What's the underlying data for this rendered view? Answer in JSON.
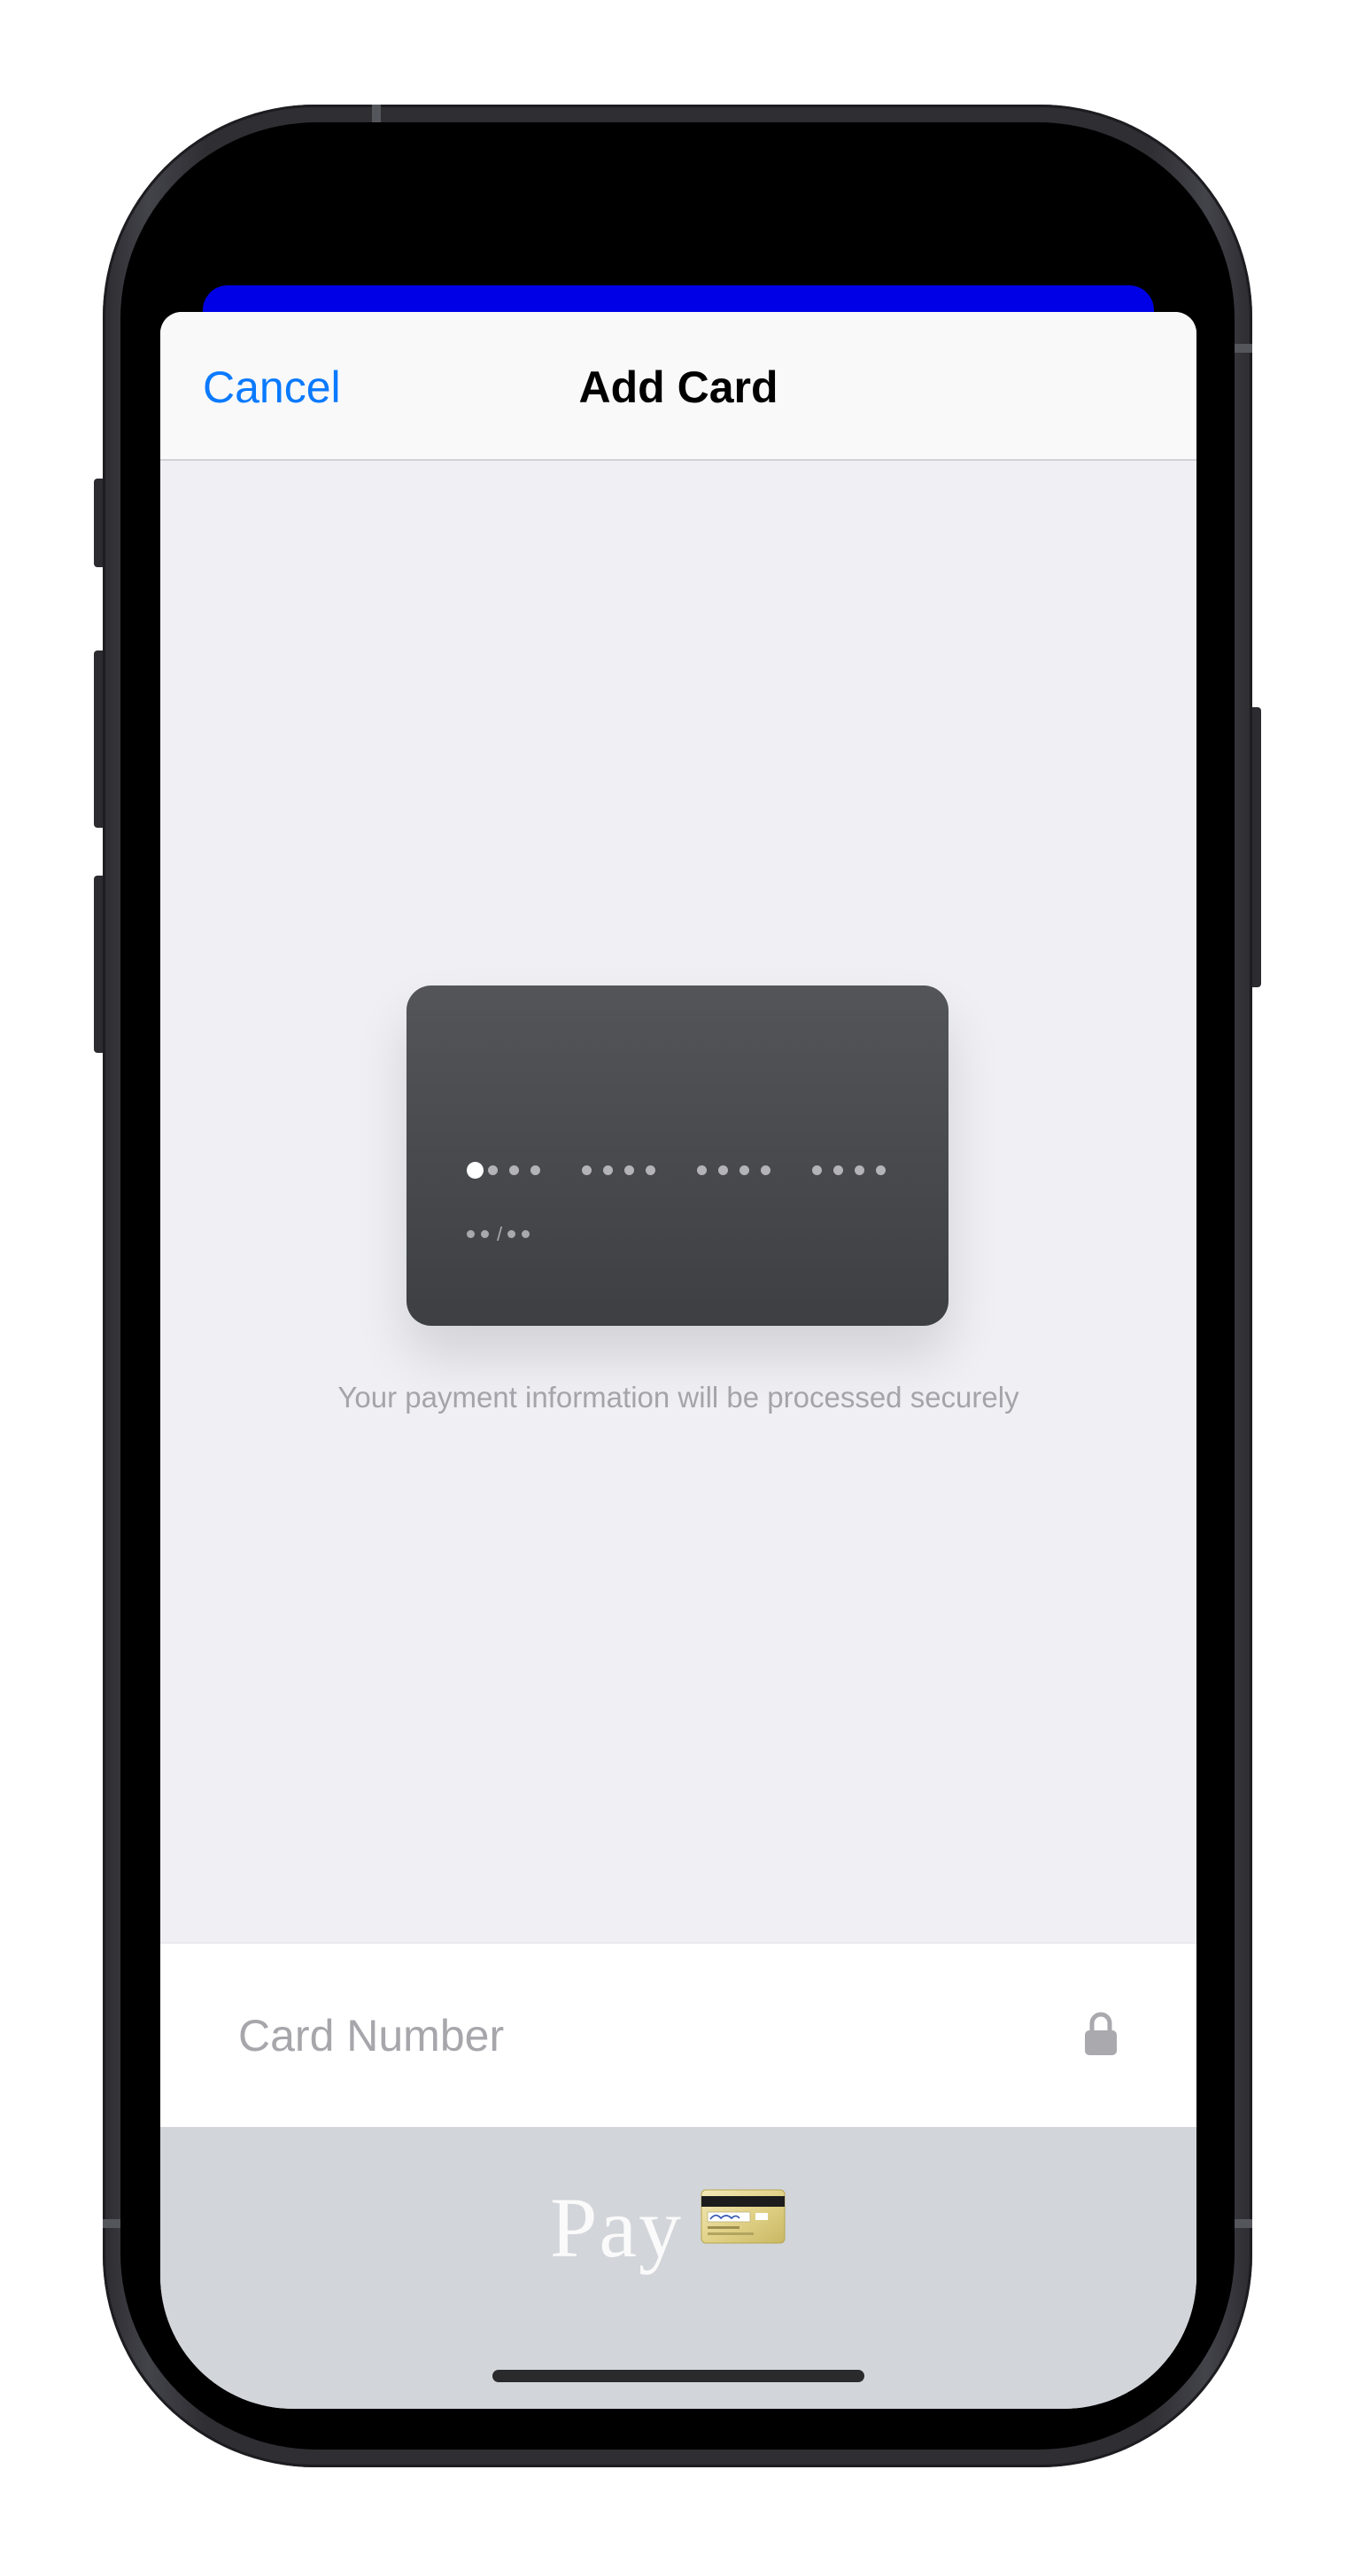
{
  "nav": {
    "cancel_label": "Cancel",
    "title": "Add Card"
  },
  "card_preview": {
    "number_groups": 4,
    "digits_per_group": 4,
    "cursor_position": 0,
    "expiry_mask_slash": "/"
  },
  "secure_message": "Your payment information will be processed securely",
  "card_number_field": {
    "placeholder": "Card Number",
    "value": "",
    "icon": "lock-icon"
  },
  "pay_button": {
    "label": "Pay",
    "icon": "credit-card-icon"
  },
  "colors": {
    "accent": "#0a7aff",
    "background_sheet_top": "#0000e6",
    "card_background": "#48494d",
    "keyboard_background": "#d2d5da"
  }
}
